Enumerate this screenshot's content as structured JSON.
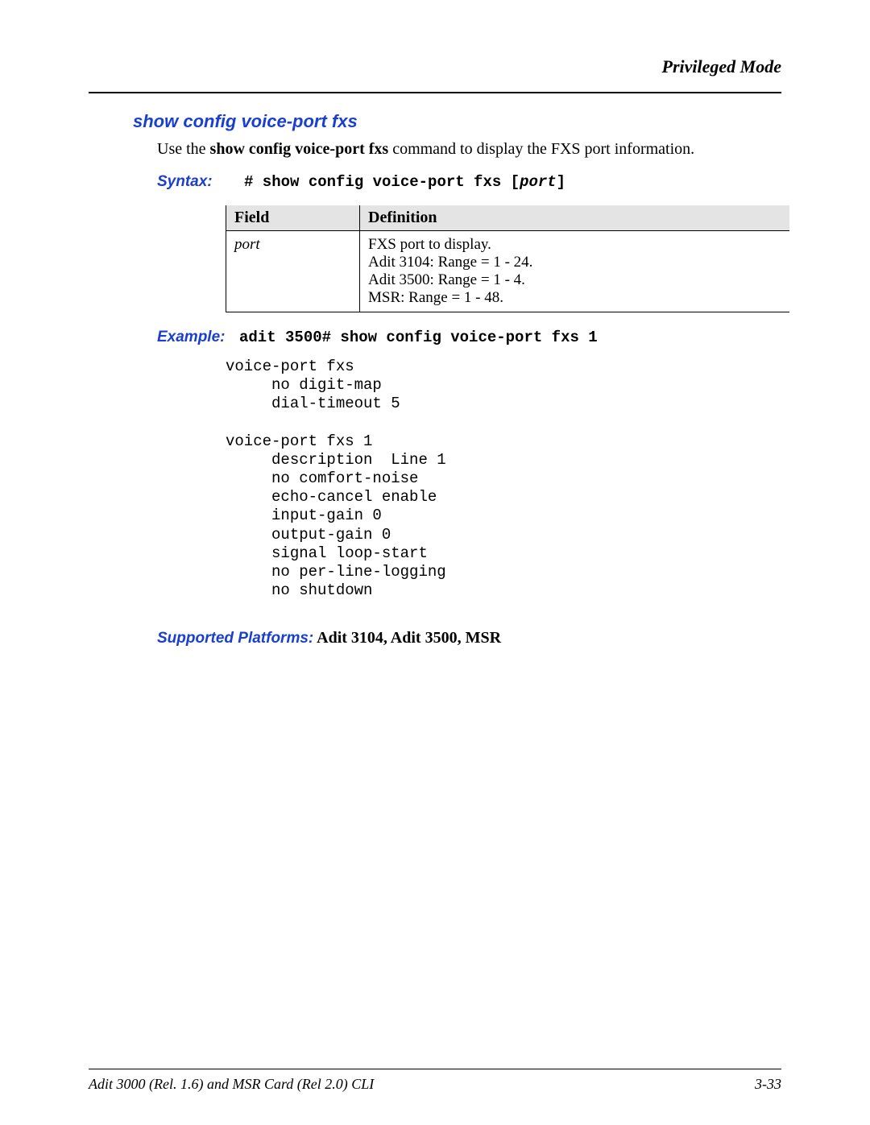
{
  "header": {
    "mode": "Privileged Mode"
  },
  "section": {
    "title": "show config voice-port fxs",
    "intro_prefix": "Use the ",
    "intro_bold": "show config voice-port fxs",
    "intro_suffix": " command to display the FXS port information."
  },
  "syntax": {
    "label": "Syntax:",
    "prefix": "# show config voice-port fxs [",
    "param": "port",
    "suffix": "]"
  },
  "table": {
    "headers": {
      "field": "Field",
      "definition": "Definition"
    },
    "row": {
      "field": "port",
      "def_line1": "FXS port to display.",
      "def_l2_bold": "Adit 3104:",
      "def_l2_rest": "  Range = 1 - 24.",
      "def_l3_bold": "Adit 3500:",
      "def_l3_rest": "  Range = 1 - 4.",
      "def_l4_bold": "MSR:",
      "def_l4_rest": "  Range = 1 - 48."
    }
  },
  "example": {
    "label": "Example:",
    "command": "adit 3500# show config voice-port fxs 1",
    "output": "voice-port fxs\n     no digit-map\n     dial-timeout 5\n\nvoice-port fxs 1\n     description  Line 1\n     no comfort-noise\n     echo-cancel enable\n     input-gain 0\n     output-gain 0\n     signal loop-start\n     no per-line-logging\n     no shutdown"
  },
  "supported": {
    "label": "Supported Platforms:",
    "value": "  Adit 3104, Adit 3500, MSR"
  },
  "footer": {
    "left": "Adit 3000 (Rel. 1.6) and MSR Card (Rel 2.0) CLI",
    "right": "3-33"
  }
}
